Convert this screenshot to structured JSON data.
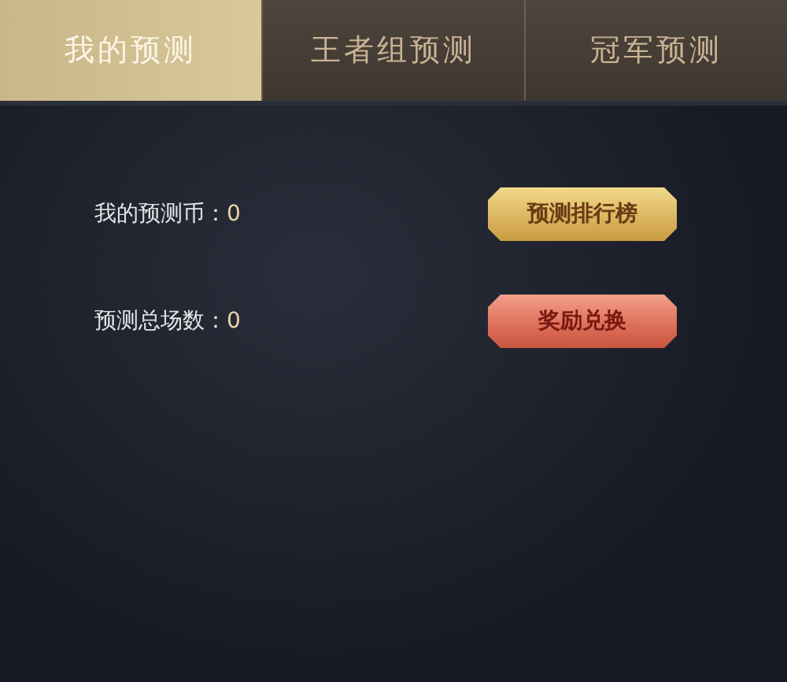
{
  "tabs": [
    {
      "label": "我的预测",
      "selected": true
    },
    {
      "label": "王者组预测",
      "selected": false
    },
    {
      "label": "冠军预测",
      "selected": false
    }
  ],
  "stats": [
    {
      "label": "我的预测币：",
      "value": "0",
      "button": {
        "label": "预测排行榜",
        "kind": "gold"
      }
    },
    {
      "label": "预测总场数：",
      "value": "0",
      "button": {
        "label": "奖励兑换",
        "kind": "red"
      }
    }
  ]
}
